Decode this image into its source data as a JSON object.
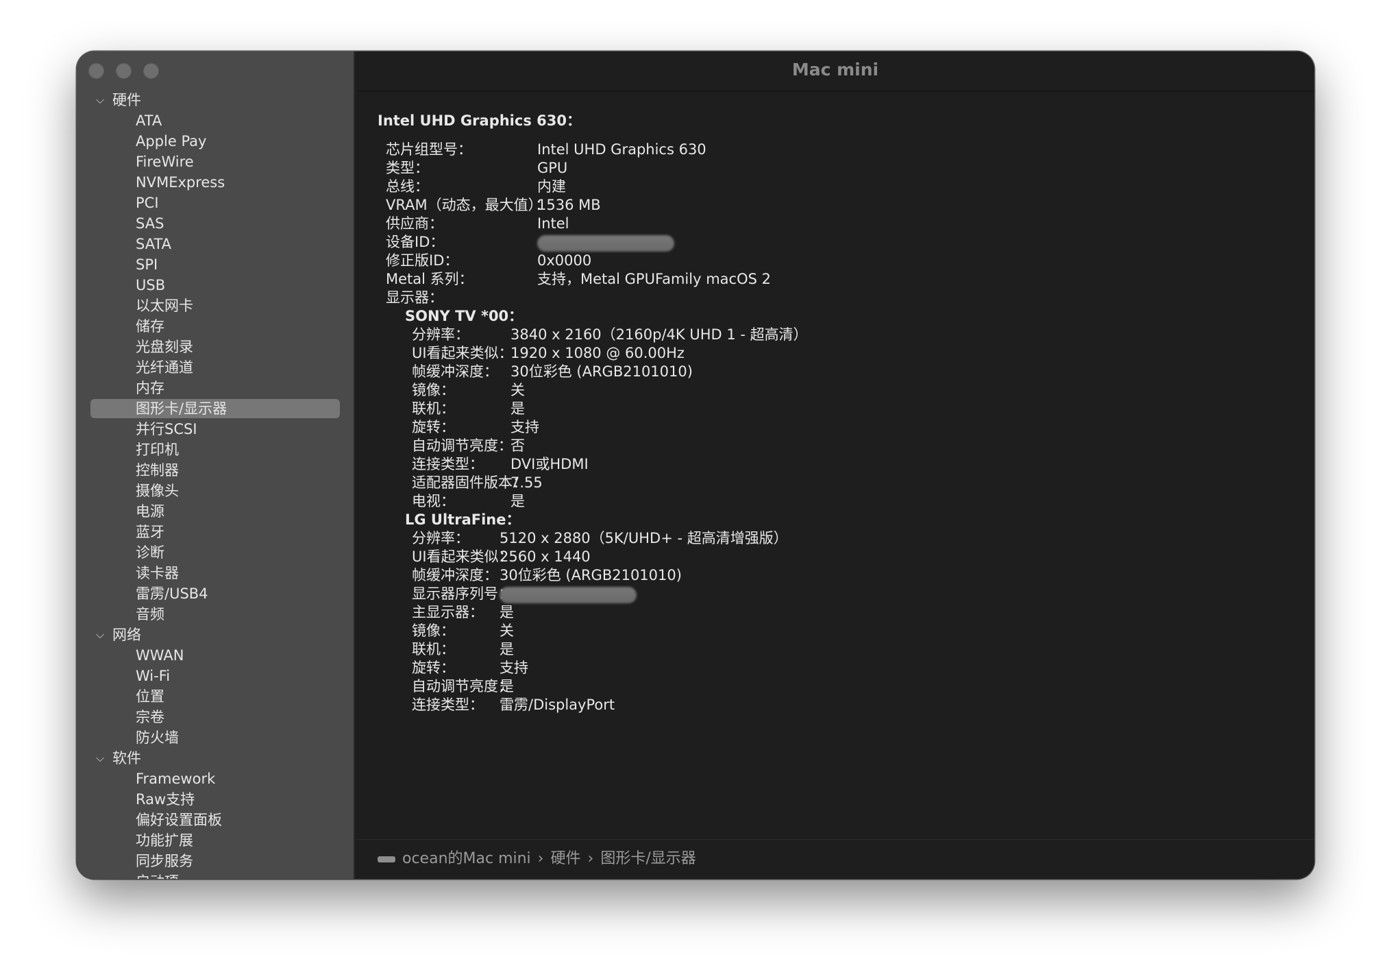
{
  "window": {
    "title": "Mac mini"
  },
  "sidebar": {
    "groups": [
      {
        "label": "硬件",
        "items": [
          "ATA",
          "Apple Pay",
          "FireWire",
          "NVMExpress",
          "PCI",
          "SAS",
          "SATA",
          "SPI",
          "USB",
          "以太网卡",
          "储存",
          "光盘刻录",
          "光纤通道",
          "内存",
          "图形卡/显示器",
          "并行SCSI",
          "打印机",
          "控制器",
          "摄像头",
          "电源",
          "蓝牙",
          "诊断",
          "读卡器",
          "雷雳/USB4",
          "音频"
        ]
      },
      {
        "label": "网络",
        "items": [
          "WWAN",
          "Wi-Fi",
          "位置",
          "宗卷",
          "防火墙"
        ]
      },
      {
        "label": "软件",
        "items": [
          "Framework",
          "Raw支持",
          "偏好设置面板",
          "功能扩展",
          "同步服务",
          "启动项"
        ]
      }
    ],
    "selected": "图形卡/显示器"
  },
  "content": {
    "heading": "Intel UHD Graphics 630：",
    "props": [
      {
        "k": "芯片组型号：",
        "v": "Intel UHD Graphics 630"
      },
      {
        "k": "类型：",
        "v": "GPU"
      },
      {
        "k": "总线：",
        "v": "内建"
      },
      {
        "k": "VRAM（动态，最大值）：",
        "v": "1536 MB"
      },
      {
        "k": "供应商：",
        "v": "Intel"
      },
      {
        "k": "设备ID：",
        "v": ""
      },
      {
        "k": "修正版ID：",
        "v": "0x0000"
      },
      {
        "k": "Metal 系列：",
        "v": "支持，Metal GPUFamily macOS 2"
      },
      {
        "k": "显示器：",
        "v": ""
      }
    ],
    "displays": [
      {
        "name": "SONY TV  *00：",
        "props": [
          {
            "k": "分辨率：",
            "v": "3840 x 2160（2160p/4K UHD 1 - 超高清）"
          },
          {
            "k": "UI看起来类似：",
            "v": "1920 x 1080 @ 60.00Hz"
          },
          {
            "k": "帧缓冲深度：",
            "v": "30位彩色 (ARGB2101010)"
          },
          {
            "k": "镜像：",
            "v": "关"
          },
          {
            "k": "联机：",
            "v": "是"
          },
          {
            "k": "旋转：",
            "v": "支持"
          },
          {
            "k": "自动调节亮度：",
            "v": "否"
          },
          {
            "k": "连接类型：",
            "v": "DVI或HDMI"
          },
          {
            "k": "适配器固件版本：",
            "v": "7.55"
          },
          {
            "k": "电视：",
            "v": "是"
          }
        ]
      },
      {
        "name": "LG UltraFine：",
        "props": [
          {
            "k": "分辨率：",
            "v": "5120 x 2880（5K/UHD+ - 超高清增强版）"
          },
          {
            "k": "UI看起来类似：",
            "v": "2560 x 1440"
          },
          {
            "k": "帧缓冲深度：",
            "v": "30位彩色 (ARGB2101010)"
          },
          {
            "k": "显示器序列号：",
            "v": ""
          },
          {
            "k": "主显示器：",
            "v": "是"
          },
          {
            "k": "镜像：",
            "v": "关"
          },
          {
            "k": "联机：",
            "v": "是"
          },
          {
            "k": "旋转：",
            "v": "支持"
          },
          {
            "k": "自动调节亮度：",
            "v": "是"
          },
          {
            "k": "连接类型：",
            "v": "雷雳/DisplayPort"
          }
        ]
      }
    ]
  },
  "pathbar": {
    "crumbs": [
      "ocean的Mac mini",
      "硬件",
      "图形卡/显示器"
    ],
    "separator": "›"
  },
  "colors": {
    "sidebar_bg": "#4a4a4a",
    "main_bg": "#1e1e1e",
    "selection": "#777777"
  }
}
